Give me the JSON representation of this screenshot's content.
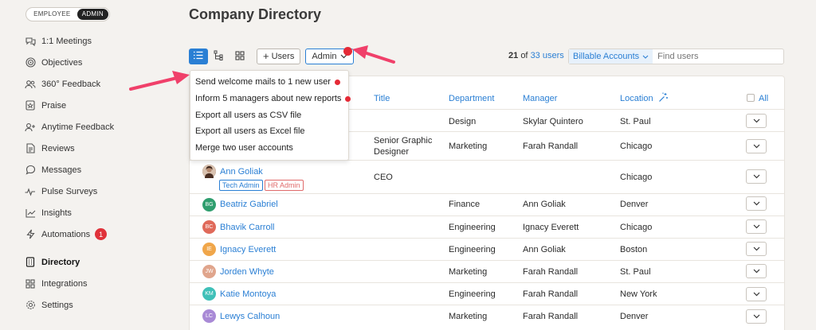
{
  "sidebar": {
    "toggle": {
      "employee": "EMPLOYEE",
      "admin": "ADMIN"
    },
    "items": [
      {
        "label": "1:1 Meetings",
        "icon": "chat-bubbles-icon"
      },
      {
        "label": "Objectives",
        "icon": "target-icon"
      },
      {
        "label": "360° Feedback",
        "icon": "people-icon"
      },
      {
        "label": "Praise",
        "icon": "praise-card-icon"
      },
      {
        "label": "Anytime Feedback",
        "icon": "person-add-icon"
      },
      {
        "label": "Reviews",
        "icon": "document-icon"
      },
      {
        "label": "Messages",
        "icon": "speech-bubble-icon"
      },
      {
        "label": "Pulse Surveys",
        "icon": "pulse-icon"
      },
      {
        "label": "Insights",
        "icon": "chart-icon"
      },
      {
        "label": "Automations",
        "icon": "lightning-icon",
        "badge": "1"
      }
    ],
    "items2": [
      {
        "label": "Directory",
        "icon": "building-icon",
        "active": true
      },
      {
        "label": "Integrations",
        "icon": "grid-icon"
      },
      {
        "label": "Settings",
        "icon": "gear-icon"
      }
    ]
  },
  "page": {
    "title": "Company Directory"
  },
  "toolbar": {
    "users_button": "Users",
    "admin_button": "Admin",
    "count_current": "21",
    "count_of": "of",
    "count_total": "33 users",
    "filter_select": "Billable Accounts",
    "search_placeholder": "Find users"
  },
  "dropdown": {
    "items": [
      {
        "label": "Send welcome mails to 1 new user",
        "dot": true
      },
      {
        "label": "Inform 5 managers about new reports",
        "dot": true
      },
      {
        "label": "Export all users as CSV file",
        "dot": false
      },
      {
        "label": "Export all users as Excel file",
        "dot": false
      },
      {
        "label": "Merge two user accounts",
        "dot": false
      }
    ]
  },
  "table": {
    "headers": {
      "title": "Title",
      "department": "Department",
      "manager": "Manager",
      "location": "Location",
      "all": "All"
    },
    "rows": [
      {
        "name": "",
        "initials": "",
        "title": "",
        "department": "Design",
        "manager": "Skylar Quintero",
        "location": "St. Paul"
      },
      {
        "name": "",
        "initials": "",
        "title_line1": "Senior Graphic",
        "title_line2": "Designer",
        "department": "Marketing",
        "manager": "Farah Randall",
        "location": "Chicago"
      },
      {
        "name": "Ann Goliak",
        "initials": "",
        "title": "CEO",
        "department": "",
        "manager": "",
        "location": "Chicago",
        "tags": [
          "Tech Admin",
          "HR Admin"
        ]
      },
      {
        "name": "Beatriz Gabriel",
        "initials": "BG",
        "title": "",
        "department": "Finance",
        "manager": "Ann Goliak",
        "location": "Denver",
        "color": "#2f9e6e"
      },
      {
        "name": "Bhavik Carroll",
        "initials": "BC",
        "title": "",
        "department": "Engineering",
        "manager": "Ignacy Everett",
        "location": "Chicago",
        "color": "#e06a5a"
      },
      {
        "name": "Ignacy Everett",
        "initials": "IE",
        "title": "",
        "department": "Engineering",
        "manager": "Ann Goliak",
        "location": "Boston",
        "color": "#f0a64a"
      },
      {
        "name": "Jorden Whyte",
        "initials": "JW",
        "title": "",
        "department": "Marketing",
        "manager": "Farah Randall",
        "location": "St. Paul",
        "color": "#e0a58c"
      },
      {
        "name": "Katie Montoya",
        "initials": "KM",
        "title": "",
        "department": "Engineering",
        "manager": "Farah Randall",
        "location": "New York",
        "color": "#3fc0b8"
      },
      {
        "name": "Lewys Calhoun",
        "initials": "LC",
        "title": "",
        "department": "Marketing",
        "manager": "Farah Randall",
        "location": "Denver",
        "color": "#a98ad6"
      }
    ]
  },
  "colors": {
    "accent": "#2a7fd4",
    "alert": "#e52a36",
    "arrow": "#f0406a"
  }
}
